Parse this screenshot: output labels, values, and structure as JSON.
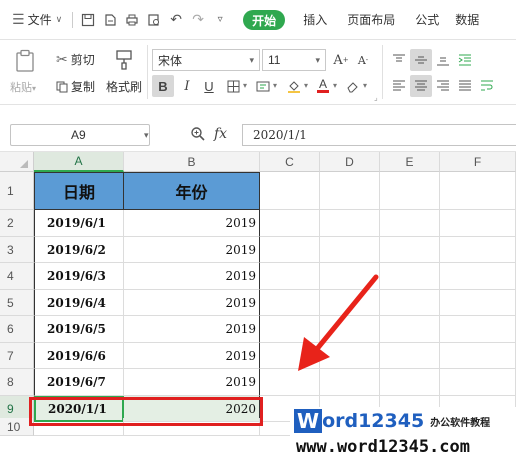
{
  "menubar": {
    "menu_label": "文件",
    "tabs": [
      "开始",
      "插入",
      "页面布局",
      "公式",
      "数据"
    ],
    "active_tab": "开始"
  },
  "ribbon": {
    "cut": "剪切",
    "copy": "复制",
    "format_painter": "格式刷",
    "paste": "粘贴",
    "font_name": "宋体",
    "font_size": "11",
    "bold": "B",
    "italic": "I",
    "underline": "U",
    "font_grow": "A",
    "font_shrink": "A",
    "font_color_letter": "A"
  },
  "formula_bar": {
    "name_box": "A9",
    "fx_label": "fx",
    "formula": "2020/1/1"
  },
  "sheet": {
    "columns": [
      "A",
      "B",
      "C",
      "D",
      "E",
      "F"
    ],
    "header_row": {
      "row": "1",
      "a": "日期",
      "b": "年份"
    },
    "rows": [
      {
        "row": "2",
        "a": "2019/6/1",
        "b": "2019"
      },
      {
        "row": "3",
        "a": "2019/6/2",
        "b": "2019"
      },
      {
        "row": "4",
        "a": "2019/6/3",
        "b": "2019"
      },
      {
        "row": "5",
        "a": "2019/6/4",
        "b": "2019"
      },
      {
        "row": "6",
        "a": "2019/6/5",
        "b": "2019"
      },
      {
        "row": "7",
        "a": "2019/6/6",
        "b": "2019"
      },
      {
        "row": "8",
        "a": "2019/6/7",
        "b": "2019"
      },
      {
        "row": "9",
        "a": "2020/1/1",
        "b": "2020"
      }
    ],
    "extra_row": "10",
    "selected_cell": "A9",
    "highlight_color": "#e02020",
    "header_fill": "#5b9bd5"
  },
  "watermark": {
    "logo_w": "W",
    "logo_rest": "ord12345",
    "tagline": "办公软件教程",
    "url": "www.word12345.com"
  },
  "colors": {
    "accent": "#2fa84f",
    "arrow": "#e8231a"
  }
}
